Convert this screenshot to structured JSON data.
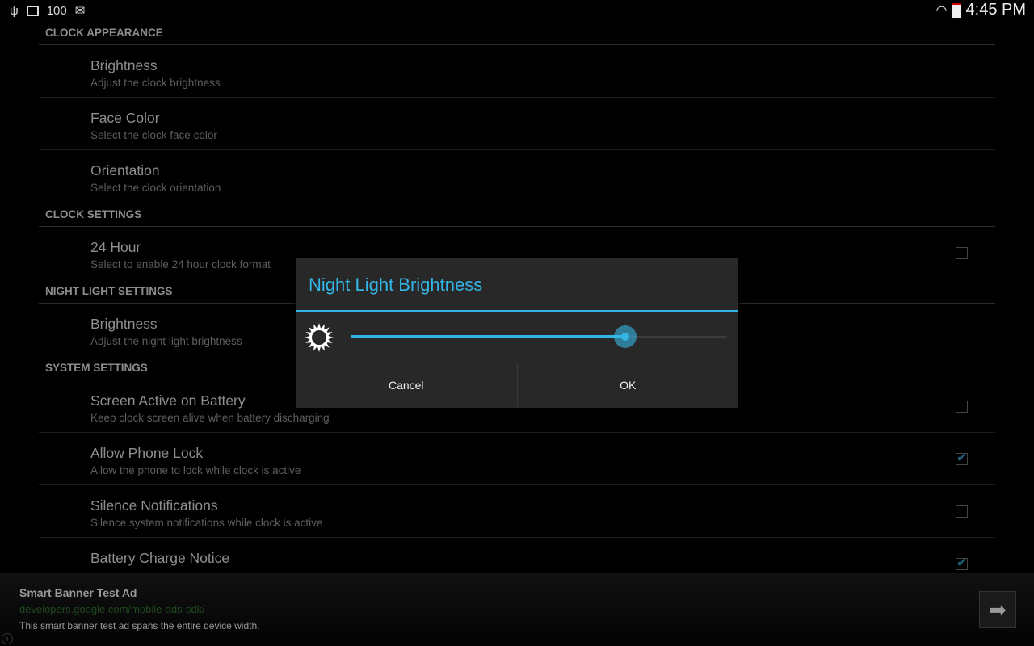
{
  "status": {
    "battery_text": "100",
    "time": "4:45 PM",
    "icons": [
      "usb-icon",
      "image-icon",
      "email-icon",
      "wifi-icon",
      "battery-icon"
    ]
  },
  "sections": [
    {
      "header": "CLOCK APPEARANCE",
      "items": [
        {
          "title": "Brightness",
          "summary": "Adjust the clock brightness"
        },
        {
          "title": "Face Color",
          "summary": "Select the clock face color"
        },
        {
          "title": "Orientation",
          "summary": "Select the clock orientation"
        }
      ]
    },
    {
      "header": "CLOCK SETTINGS",
      "items": [
        {
          "title": "24 Hour",
          "summary": "Select to enable 24 hour clock format",
          "checked": false
        }
      ]
    },
    {
      "header": "NIGHT LIGHT SETTINGS",
      "items": [
        {
          "title": "Brightness",
          "summary": "Adjust the night light brightness"
        }
      ]
    },
    {
      "header": "SYSTEM SETTINGS",
      "items": [
        {
          "title": "Screen Active on Battery",
          "summary": "Keep clock screen alive when battery discharging",
          "checked": false
        },
        {
          "title": "Allow Phone Lock",
          "summary": "Allow the phone to lock while clock is active",
          "checked": true
        },
        {
          "title": "Silence Notifications",
          "summary": "Silence system notifications while clock is active",
          "checked": false
        },
        {
          "title": "Battery Charge Notice",
          "summary": "",
          "checked": true
        }
      ]
    }
  ],
  "dialog": {
    "title": "Night Light Brightness",
    "slider_value_percent": 73,
    "cancel": "Cancel",
    "ok": "OK",
    "accent": "#33b5e5"
  },
  "ad": {
    "title": "Smart Banner Test Ad",
    "url": "developers.google.com/mobile-ads-sdk/",
    "description": "This smart banner test ad spans the entire device width."
  }
}
